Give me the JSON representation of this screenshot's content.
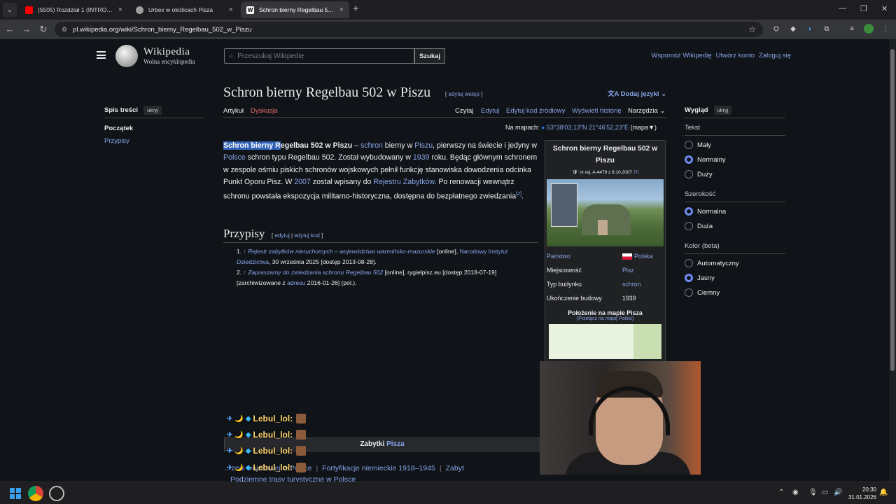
{
  "browser": {
    "tabs": [
      {
        "title": "(5505) Rozdział 1 (INTRO) - You",
        "favicon_color": "#ff0000"
      },
      {
        "title": "Urbex w okolicach Pisza",
        "favicon_color": "#9e9e9e"
      },
      {
        "title": "Schron bierny Regelbau 502 w",
        "favicon_color": "#ffffff"
      }
    ],
    "url": "pl.wikipedia.org/wiki/Schron_bierny_Regelbau_502_w_Piszu"
  },
  "wiki_header": {
    "wordmark": "Wikipedia",
    "tagline": "Wolna encyklopedia",
    "search_placeholder": "Przeszukaj Wikipedię",
    "search_button": "Szukaj",
    "links": [
      "Wspomóż Wikipedię",
      "Utwórz konto",
      "Zaloguj się"
    ]
  },
  "toc": {
    "title": "Spis treści",
    "hide": "ukryj",
    "items": [
      "Początek",
      "Przypisy"
    ]
  },
  "appearance": {
    "title": "Wygląd",
    "hide": "ukryj",
    "text_label": "Tekst",
    "text_options": [
      "Mały",
      "Normalny",
      "Duży"
    ],
    "width_label": "Szerokość",
    "width_options": [
      "Normalna",
      "Duża"
    ],
    "color_label": "Kolor (beta)",
    "color_options": [
      "Automatyczny",
      "Jasny",
      "Ciemny"
    ]
  },
  "article": {
    "title": "Schron bierny Regelbau 502 w Piszu",
    "edit_intro": "edytuj wstęp",
    "add_languages": "Dodaj języki",
    "tabs_left": [
      "Artykuł",
      "Dyskusja"
    ],
    "tabs_right": [
      "Czytaj",
      "Edytuj",
      "Edytuj kod źródłowy",
      "Wyświetl historię",
      "Narzędzia"
    ],
    "coords_label": "Na mapach:",
    "coords": "53°38′03,13″N 21°46′52,23″E",
    "coords_map": "(mapa▼)",
    "para": {
      "t1": "Schron bierny R",
      "t2": "egelbau 502 w Piszu",
      "t3": " – ",
      "l1": "schron",
      "t4": " bierny w ",
      "l2": "Piszu",
      "t5": ", pierwszy na świecie i jedyny w ",
      "l3": "Polsce",
      "t6": " schron typu Regelbau 502. Został wybudowany w ",
      "l4": "1939",
      "t7": " roku. Będąc głównym schronem w zespole ośmiu piskich schronów wojskowych pełnił funkcję stanowiska dowodzenia odcinka Punkt Oporu Pisz. W ",
      "l5": "2007",
      "t8": " został wpisany do ",
      "l6": "Rejestru Zabytków",
      "t9": ". Po renowacji wewnątrz schronu powstała ekspozycja militarno-historyczna, dostępna do bezpłatnego zwiedzania",
      "ref": "[2]",
      "t10": "."
    },
    "refs_heading": "Przypisy",
    "refs_edit": "edytuj",
    "refs_edit_code": "edytuj kod",
    "refs": [
      {
        "n": "1.",
        "link": "Rejestr zabytków nieruchomych – województwo warmińsko-mazurskie",
        "rest1": " [online], ",
        "pub": "Narodowy Instytut Dziedzictwa",
        "rest2": ", 30 września 2025 [dostęp 2013-08-28]."
      },
      {
        "n": "2.",
        "link": "Zapraszamy do zwiedzania schronu Regelbau 502",
        "rest1": " [online], rygielpisz.eu [dostęp 2018-07-19] [zarchiwizowane z ",
        "pub": "adresu",
        "rest2": " 2016-01-26] (pol.)."
      }
    ]
  },
  "infobox": {
    "title": "Schron bierny Regelbau 502 w Piszu",
    "register": "nr rej. A-4479 z 8.10.2007",
    "register_ref": "[1]",
    "rows": [
      {
        "k": "Państwo",
        "v": "Polska"
      },
      {
        "k": "Miejscowość",
        "v": "Pisz"
      },
      {
        "k": "Typ budynku",
        "v": "schron"
      },
      {
        "k": "Ukończenie budowy",
        "v": "1939"
      }
    ],
    "map_title": "Położenie na mapie Pisza",
    "map_switch": "(Przełącz na mapę Polski)"
  },
  "navbox": {
    "title_prefix": "Zabytki ",
    "title_link": "Pisza",
    "row": [
      "…zeni wojskowej w Polsce",
      "Fortyfikacje niemieckie 1918–1945",
      "Zabyt"
    ],
    "row2": "Podziemne trasy turystyczne w Polsce"
  },
  "chat": {
    "user": "Lebul_lol:",
    "count": 4
  },
  "clock": {
    "time": "20:30",
    "date": "31.01.2026"
  }
}
